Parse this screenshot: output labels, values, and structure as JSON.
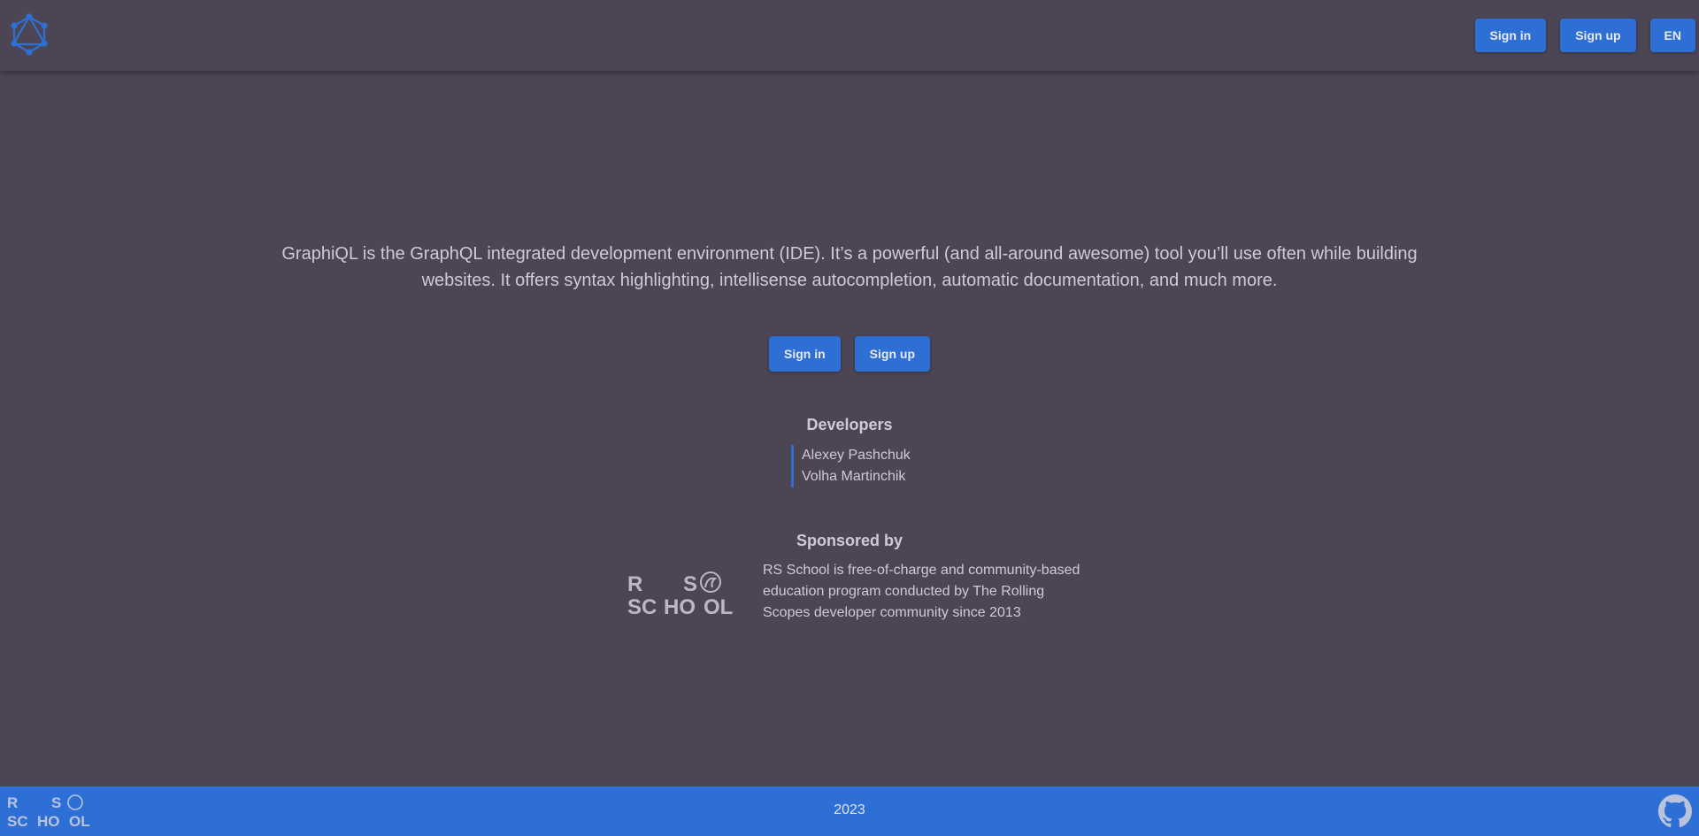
{
  "header": {
    "sign_in": "Sign in",
    "sign_up": "Sign up",
    "language": "EN",
    "logo_icon": "graphql-logo-icon"
  },
  "main": {
    "intro": "GraphiQL is the GraphQL integrated development environment (IDE). It’s a powerful (and all-around awesome) tool you’ll use often while building websites. It offers syntax highlighting, intellisense autocompletion, automatic documentation, and much more.",
    "sign_in": "Sign in",
    "sign_up": "Sign up",
    "developers_title": "Developers",
    "developers": [
      "Alexey Pashchuk",
      "Volha Martinchik"
    ],
    "sponsor_title": "Sponsored by",
    "sponsor_text": "RS School is free-of-charge and community-based education program conducted by The Rolling Scopes developer community since 2013",
    "sponsor_logo": [
      "R",
      "S",
      "SC",
      "HO",
      "OL"
    ]
  },
  "footer": {
    "year": "2023",
    "github_icon": "github-icon"
  },
  "colors": {
    "background": "#4b4554",
    "accent": "#2e6fd6",
    "text": "#cfcad6"
  }
}
